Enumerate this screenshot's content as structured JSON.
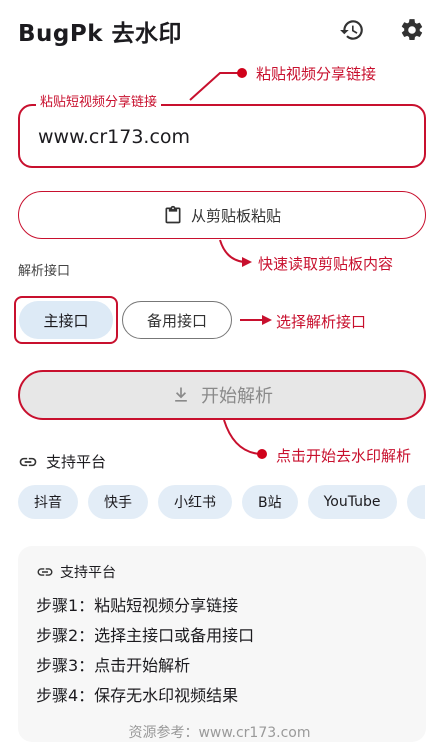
{
  "header": {
    "title": "BugPk 去水印",
    "history_icon": "history-icon",
    "settings_icon": "gear-icon"
  },
  "url_field": {
    "label": "粘贴短视频分享链接",
    "value": "www.cr173.com"
  },
  "paste_button": {
    "label": "从剪贴板粘贴",
    "icon": "clipboard-icon"
  },
  "api_section": {
    "label": "解析接口",
    "primary": "主接口",
    "backup": "备用接口"
  },
  "start_button": {
    "label": "开始解析",
    "icon": "download-icon"
  },
  "platforms": {
    "title": "支持平台",
    "icon": "link-icon",
    "items": [
      "抖音",
      "快手",
      "小红书",
      "B站",
      "YouTube"
    ]
  },
  "guide_card": {
    "title": "支持平台",
    "steps": [
      "步骤1：粘贴短视频分享链接",
      "步骤2：选择主接口或备用接口",
      "步骤3：点击开始解析",
      "步骤4：保存无水印视频结果"
    ]
  },
  "footer": {
    "text": "资源参考：www.cr173.com"
  },
  "annotations": {
    "paste_link": "粘贴视频分享链接",
    "clipboard": "快速读取剪贴板内容",
    "choose_api": "选择解析接口",
    "start": "点击开始去水印解析"
  },
  "colors": {
    "annotation": "#c8102e",
    "chip_bg": "#ddeaf6",
    "tag_bg": "#e3edf7"
  }
}
